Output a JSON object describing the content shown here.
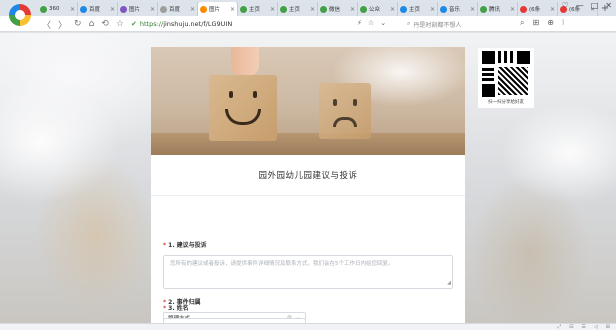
{
  "browser": {
    "tabs": [
      {
        "label": "360",
        "color": "#43a047"
      },
      {
        "label": "百度",
        "color": "#1e88e5"
      },
      {
        "label": "图片",
        "color": "#7e57c2"
      },
      {
        "label": "百度",
        "color": "#9e9e9e"
      },
      {
        "label": "图片",
        "color": "#fb8c00",
        "active": true
      },
      {
        "label": "主页",
        "color": "#43a047"
      },
      {
        "label": "主页",
        "color": "#43a047"
      },
      {
        "label": "微信",
        "color": "#43a047"
      },
      {
        "label": "公众",
        "color": "#43a047"
      },
      {
        "label": "主页",
        "color": "#1e88e5"
      },
      {
        "label": "音乐",
        "color": "#1e88e5"
      },
      {
        "label": "腾讯",
        "color": "#43a047"
      },
      {
        "label": "(6条",
        "color": "#e53935"
      },
      {
        "label": "(6条",
        "color": "#e53935"
      }
    ],
    "new_tab": "+",
    "window_controls": [
      "♡",
      "—",
      "□",
      "✕"
    ],
    "nav": {
      "back": "〈",
      "forward": "〉",
      "reload": "↻",
      "home": "⌂",
      "restore": "⟲",
      "bookmark": "☆"
    },
    "url_proto": "https://",
    "url_rest": "jinshuju.net/f/LG9UIN",
    "url_tools": [
      "⚡",
      "☆",
      "⌄"
    ],
    "search_placeholder": "丹是时刻都不想人",
    "toolbar_right": [
      "⌕",
      "⊞",
      "⊕",
      "⁝"
    ]
  },
  "form": {
    "title": "园外园幼儿园建议与投诉",
    "fields": [
      {
        "label": "1. 建议与投诉",
        "placeholder": "您所有的建议或者投诉，请提供事件详细情况及联系方式，我们会在5个工作日内给您回复。"
      },
      {
        "label": "2. 事件归属",
        "value": "管理方式",
        "clear": "⊗",
        "caret": "⌄"
      },
      {
        "label": "3. 姓名"
      }
    ],
    "resize_glyph": "◢",
    "required_mark": "*"
  },
  "qr": {
    "caption": "扫一扫分享给好友"
  },
  "status_icons": [
    "⤢",
    "⊟",
    "☰",
    "◁",
    "⊞"
  ]
}
